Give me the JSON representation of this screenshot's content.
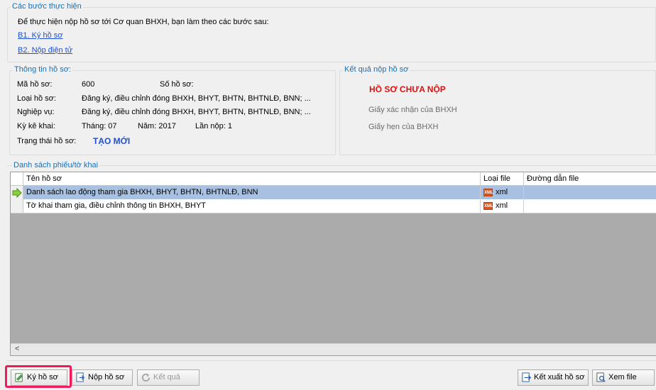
{
  "steps": {
    "legend": "Các bước thực hiện",
    "intro": "Để thực hiện nộp hồ sơ tới Cơ quan BHXH, bạn làm theo các bước sau:",
    "step1": "B1. Ký hồ sơ",
    "step2": "B2. Nộp điện tử"
  },
  "info": {
    "legend": "Thông tin hồ sơ:",
    "ma_label": "Mã hồ sơ:",
    "ma_value": "600",
    "so_label": "Số hồ sơ:",
    "loai_label": "Loại hồ sơ:",
    "loai_value": "Đăng ký, điều chỉnh đóng BHXH, BHYT, BHTN, BHTNLĐ, BNN; ...",
    "nghiepvu_label": "Nghiệp vụ:",
    "nghiepvu_value": "Đăng ký, điều chỉnh đóng BHXH, BHYT, BHTN, BHTNLĐ, BNN; ...",
    "kykhai_label": "Kỳ kê khai:",
    "thang": "Tháng: 07",
    "nam": "Năm: 2017",
    "lannop": "Lần nộp: 1",
    "trangthai_label": "Trạng thái hồ sơ:",
    "trangthai_value": "TẠO MỚI"
  },
  "result": {
    "legend": "Kết quả nộp hồ sơ",
    "status": "HỒ SƠ CHƯA NỘP",
    "giay_xac_nhan": "Giấy xác nhận của BHXH",
    "giay_hen": "Giấy hẹn của BHXH"
  },
  "list": {
    "legend": "Danh sách phiếu/tờ khai",
    "columns": [
      "Tên hồ sơ",
      "Loại file",
      "Đường dẫn file"
    ],
    "rows": [
      {
        "name": "Danh sách lao động tham gia BHXH, BHYT, BHTN, BHTNLĐ, BNN",
        "type": "xml",
        "path": ""
      },
      {
        "name": "Tờ khai tham gia, điều chỉnh thông tin BHXH, BHYT",
        "type": "xml",
        "path": ""
      }
    ],
    "scroll_left": "<"
  },
  "buttons": {
    "ky_ho_so": "Ký hồ sơ",
    "nop_ho_so": "Nộp hồ sơ",
    "ket_qua": "Kết quả",
    "ket_xuat": "Kết xuất hồ sơ",
    "xem_file": "Xem file"
  },
  "colors": {
    "accent_red": "#e01010",
    "status_blue": "#1f4fd1",
    "selection": "#a9c1e0",
    "highlight": "#ee1c5a"
  }
}
